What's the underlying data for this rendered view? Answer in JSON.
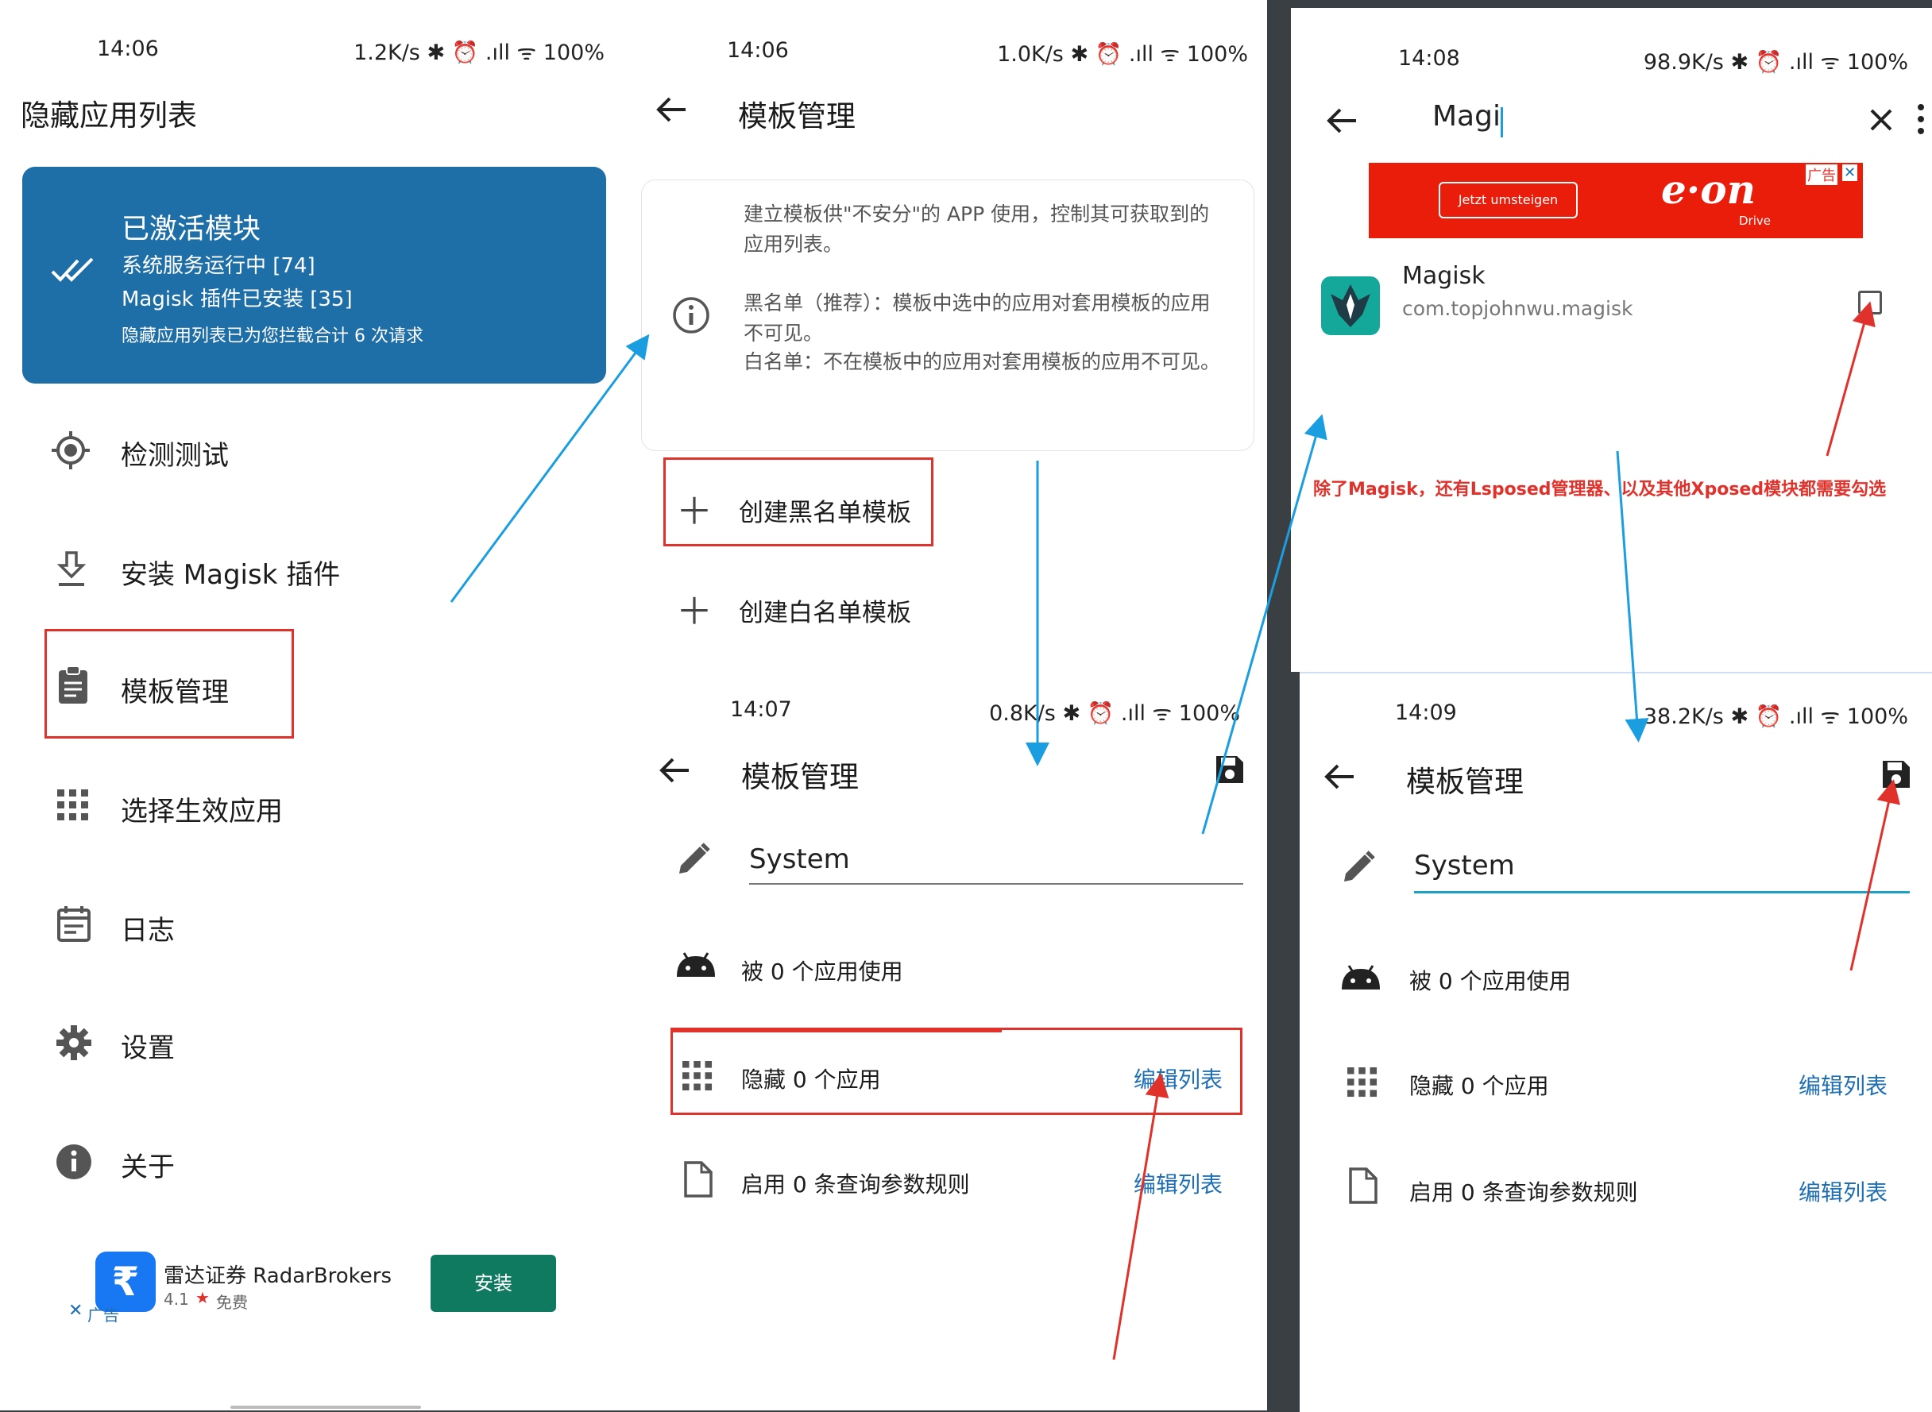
{
  "status_icons": "✱ ⏰ .ıll ᯤ",
  "panel1": {
    "time": "14:06",
    "speed": "1.2K/s",
    "battery": "100%",
    "title": "隐藏应用列表",
    "card": {
      "title": "已激活模块",
      "line1": "系统服务运行中 [74]",
      "line2": "Magisk 插件已安装 [35]",
      "line3": "隐藏应用列表已为您拦截合计 6 次请求"
    },
    "menu": [
      {
        "label": "检测测试",
        "icon": "target-icon"
      },
      {
        "label": "安装 Magisk 插件",
        "icon": "download-icon"
      },
      {
        "label": "模板管理",
        "icon": "clipboard-icon"
      },
      {
        "label": "选择生效应用",
        "icon": "apps-grid-icon"
      },
      {
        "label": "日志",
        "icon": "calendar-icon"
      },
      {
        "label": "设置",
        "icon": "gear-icon"
      },
      {
        "label": "关于",
        "icon": "info-icon"
      }
    ],
    "ad": {
      "app_name": "雷达证券 RadarBrokers",
      "rating": "4.1",
      "free": "免费",
      "tag": "广告",
      "install": "安装"
    }
  },
  "panel2": {
    "time": "14:06",
    "speed": "1.0K/s",
    "battery": "100%",
    "title": "模板管理",
    "info": {
      "p1": "建立模板供\"不安分\"的 APP 使用，控制其可获取到的应用列表。",
      "p2": "黑名单（推荐）：模板中选中的应用对套用模板的应用不可见。",
      "p3": "白名单：不在模板中的应用对套用模板的应用不可见。"
    },
    "create_black": "创建黑名单模板",
    "create_white": "创建白名单模板"
  },
  "panel3": {
    "time": "14:07",
    "speed": "0.8K/s",
    "battery": "100%",
    "title": "模板管理",
    "name_value": "System",
    "used_by": "被 0 个应用使用",
    "hide_count": "隐藏 0 个应用",
    "query_rules": "启用 0 条查询参数规则",
    "edit_list": "编辑列表"
  },
  "panel4": {
    "time": "14:08",
    "speed": "98.9K/s",
    "battery": "100%",
    "search_value": "Magi",
    "ad_button": "Jetzt umsteigen",
    "ad_brand": "e·on",
    "ad_sub": "Drive",
    "ad_tag": "广告",
    "app_name": "Magisk",
    "app_pkg": "com.topjohnwu.magisk"
  },
  "panel5": {
    "time": "14:09",
    "speed": "38.2K/s",
    "battery": "100%",
    "title": "模板管理",
    "name_value": "System",
    "used_by": "被 0 个应用使用",
    "hide_count": "隐藏 0 个应用",
    "query_rules": "启用 0 条查询参数规则",
    "edit_list": "编辑列表"
  },
  "annotation": "除了Magisk，还有Lsposed管理器、以及其他Xposed模块都需要勾选",
  "colors": {
    "card_blue": "#1e6ea7",
    "link_blue": "#1f6fb4",
    "red": "#e0312b",
    "arrow_blue": "#1a9ee0",
    "install_green": "#0f7a5f",
    "eon_red": "#ea1c0a"
  }
}
